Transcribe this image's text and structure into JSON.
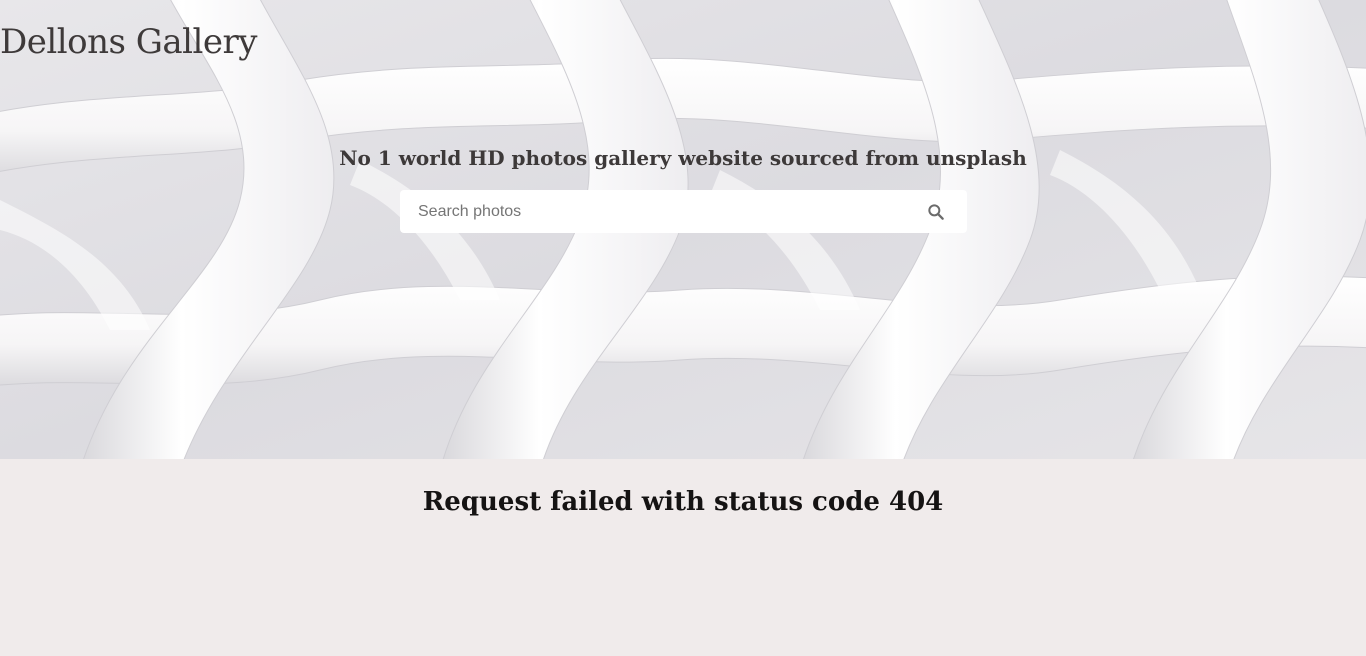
{
  "header": {
    "site_title": "Dellons Gallery"
  },
  "hero": {
    "tagline": "No 1 world HD photos gallery website sourced from unsplash"
  },
  "search": {
    "placeholder": "Search photos",
    "value": "",
    "icon": "search-icon"
  },
  "content": {
    "error_message": "Request failed with status code 404"
  },
  "colors": {
    "page_background": "#f0ebeb",
    "title_text": "#3e3a3a",
    "error_text": "#151313"
  }
}
